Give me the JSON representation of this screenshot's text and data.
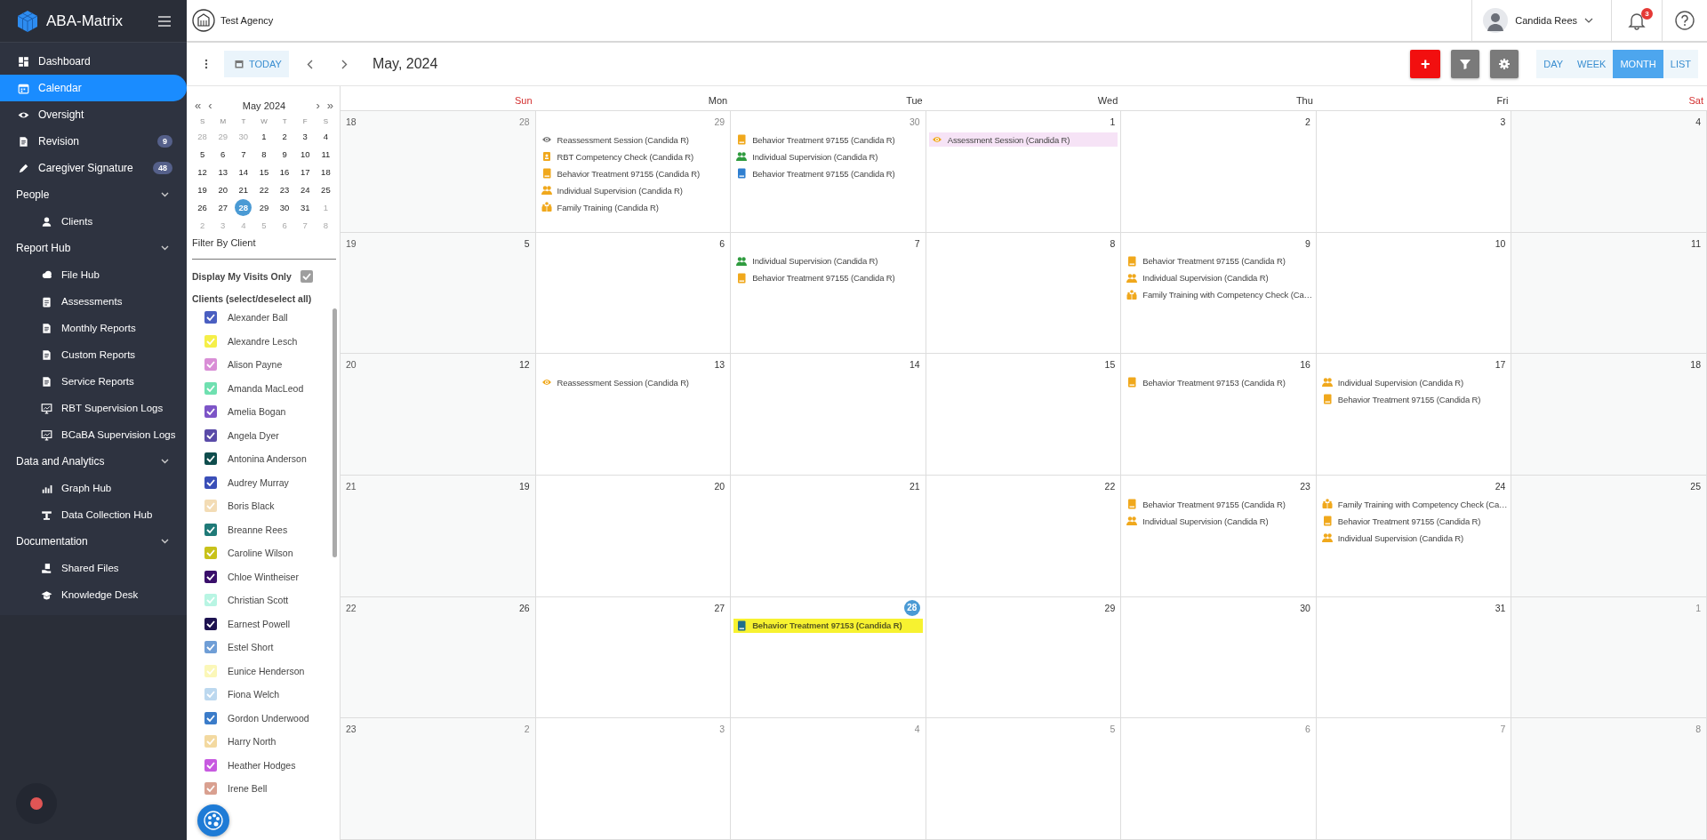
{
  "app": {
    "name": "ABA-Matrix"
  },
  "agency": {
    "name": "Test Agency"
  },
  "user": {
    "name": "Candida Rees",
    "notifications": "3"
  },
  "sidebar": {
    "items": [
      {
        "label": "Dashboard",
        "selected": false
      },
      {
        "label": "Calendar",
        "selected": true
      },
      {
        "label": "Oversight",
        "selected": false
      },
      {
        "label": "Revision",
        "selected": false,
        "badge": "9"
      },
      {
        "label": "Caregiver Signature",
        "selected": false,
        "badge": "48"
      },
      {
        "label": "People",
        "expanded": true,
        "children": [
          {
            "label": "Clients",
            "selected": false
          }
        ]
      },
      {
        "label": "Report Hub",
        "expanded": true,
        "children": [
          {
            "label": "File Hub",
            "selected": false
          },
          {
            "label": "Assessments",
            "selected": false
          },
          {
            "label": "Monthly Reports",
            "selected": false
          },
          {
            "label": "Custom Reports",
            "selected": false
          },
          {
            "label": "Service Reports",
            "selected": false
          },
          {
            "label": "RBT Supervision Logs",
            "selected": false
          },
          {
            "label": "BCaBA Supervision Logs",
            "selected": false
          }
        ]
      },
      {
        "label": "Data and Analytics",
        "expanded": true,
        "children": [
          {
            "label": "Graph Hub",
            "selected": false
          },
          {
            "label": "Data Collection Hub",
            "selected": false
          }
        ]
      },
      {
        "label": "Documentation",
        "expanded": true,
        "children": [
          {
            "label": "Shared Files",
            "selected": false
          },
          {
            "label": "Knowledge Desk",
            "selected": false
          }
        ]
      }
    ]
  },
  "toolbar": {
    "today": "TODAY",
    "period": "May, 2024",
    "add": "+",
    "views": [
      {
        "label": "DAY",
        "selected": false
      },
      {
        "label": "WEEK",
        "selected": false
      },
      {
        "label": "MONTH",
        "selected": true
      },
      {
        "label": "LIST",
        "selected": false
      }
    ]
  },
  "mini_calendar": {
    "title": "May 2024",
    "first": "«",
    "prev": "‹",
    "next": "›",
    "last": "»",
    "weekdays": [
      "S",
      "M",
      "T",
      "W",
      "T",
      "F",
      "S"
    ],
    "weeks": [
      [
        {
          "day": "28",
          "other_month": true,
          "selected": false
        },
        {
          "day": "29",
          "other_month": true,
          "selected": false
        },
        {
          "day": "30",
          "other_month": true,
          "selected": false
        },
        {
          "day": "1",
          "other_month": false,
          "selected": false
        },
        {
          "day": "2",
          "other_month": false,
          "selected": false
        },
        {
          "day": "3",
          "other_month": false,
          "selected": false
        },
        {
          "day": "4",
          "other_month": false,
          "selected": false
        }
      ],
      [
        {
          "day": "5",
          "other_month": false,
          "selected": false
        },
        {
          "day": "6",
          "other_month": false,
          "selected": false
        },
        {
          "day": "7",
          "other_month": false,
          "selected": false
        },
        {
          "day": "8",
          "other_month": false,
          "selected": false
        },
        {
          "day": "9",
          "other_month": false,
          "selected": false
        },
        {
          "day": "10",
          "other_month": false,
          "selected": false
        },
        {
          "day": "11",
          "other_month": false,
          "selected": false
        }
      ],
      [
        {
          "day": "12",
          "other_month": false,
          "selected": false
        },
        {
          "day": "13",
          "other_month": false,
          "selected": false
        },
        {
          "day": "14",
          "other_month": false,
          "selected": false
        },
        {
          "day": "15",
          "other_month": false,
          "selected": false
        },
        {
          "day": "16",
          "other_month": false,
          "selected": false
        },
        {
          "day": "17",
          "other_month": false,
          "selected": false
        },
        {
          "day": "18",
          "other_month": false,
          "selected": false
        }
      ],
      [
        {
          "day": "19",
          "other_month": false,
          "selected": false
        },
        {
          "day": "20",
          "other_month": false,
          "selected": false
        },
        {
          "day": "21",
          "other_month": false,
          "selected": false
        },
        {
          "day": "22",
          "other_month": false,
          "selected": false
        },
        {
          "day": "23",
          "other_month": false,
          "selected": false
        },
        {
          "day": "24",
          "other_month": false,
          "selected": false
        },
        {
          "day": "25",
          "other_month": false,
          "selected": false
        }
      ],
      [
        {
          "day": "26",
          "other_month": false,
          "selected": false
        },
        {
          "day": "27",
          "other_month": false,
          "selected": false
        },
        {
          "day": "28",
          "other_month": false,
          "selected": true
        },
        {
          "day": "29",
          "other_month": false,
          "selected": false
        },
        {
          "day": "30",
          "other_month": false,
          "selected": false
        },
        {
          "day": "31",
          "other_month": false,
          "selected": false
        },
        {
          "day": "1",
          "other_month": true,
          "selected": false
        }
      ],
      [
        {
          "day": "2",
          "other_month": true,
          "selected": false
        },
        {
          "day": "3",
          "other_month": true,
          "selected": false
        },
        {
          "day": "4",
          "other_month": true,
          "selected": false
        },
        {
          "day": "5",
          "other_month": true,
          "selected": false
        },
        {
          "day": "6",
          "other_month": true,
          "selected": false
        },
        {
          "day": "7",
          "other_month": true,
          "selected": false
        },
        {
          "day": "8",
          "other_month": true,
          "selected": false
        }
      ]
    ]
  },
  "filter": {
    "title": "Filter By Client",
    "my_visits": {
      "label": "Display My Visits Only",
      "checked": true
    },
    "clients_heading": "Clients (select/deselect all)",
    "clients": [
      {
        "name": "Alexander Ball",
        "color": "#4a5fc1",
        "checked": true
      },
      {
        "name": "Alexandre Lesch",
        "color": "#f5ef48",
        "checked": true
      },
      {
        "name": "Alison Payne",
        "color": "#d98ed6",
        "checked": true
      },
      {
        "name": "Amanda MacLeod",
        "color": "#6fe0b0",
        "checked": true
      },
      {
        "name": "Amelia Bogan",
        "color": "#7d55c7",
        "checked": true
      },
      {
        "name": "Angela Dyer",
        "color": "#5a4ba8",
        "checked": true
      },
      {
        "name": "Antonina Anderson",
        "color": "#0f4d4d",
        "checked": true
      },
      {
        "name": "Audrey Murray",
        "color": "#3a4fb8",
        "checked": true
      },
      {
        "name": "Boris Black",
        "color": "#f3dcb5",
        "checked": true
      },
      {
        "name": "Breanne Rees",
        "color": "#1f7a78",
        "checked": true
      },
      {
        "name": "Caroline Wilson",
        "color": "#c8c21a",
        "checked": true
      },
      {
        "name": "Chloe Wintheiser",
        "color": "#3a0f6b",
        "checked": true
      },
      {
        "name": "Christian Scott",
        "color": "#b8f5e3",
        "checked": true
      },
      {
        "name": "Earnest Powell",
        "color": "#1d1250",
        "checked": true
      },
      {
        "name": "Estel Short",
        "color": "#6f9ed6",
        "checked": true
      },
      {
        "name": "Eunice Henderson",
        "color": "#fbf7b8",
        "checked": true
      },
      {
        "name": "Fiona Welch",
        "color": "#bcd8ef",
        "checked": true
      },
      {
        "name": "Gordon Underwood",
        "color": "#3b7cc9",
        "checked": true
      },
      {
        "name": "Harry North",
        "color": "#f3d9a0",
        "checked": true
      },
      {
        "name": "Heather Hodges",
        "color": "#c75ae0",
        "checked": true
      },
      {
        "name": "Irene Bell",
        "color": "#d9a090",
        "checked": true
      }
    ]
  },
  "calendar": {
    "weekdays": [
      {
        "label": "Sun",
        "weekend": true
      },
      {
        "label": "Mon",
        "weekend": false
      },
      {
        "label": "Tue",
        "weekend": false
      },
      {
        "label": "Wed",
        "weekend": false
      },
      {
        "label": "Thu",
        "weekend": false
      },
      {
        "label": "Fri",
        "weekend": false
      },
      {
        "label": "Sat",
        "weekend": true
      }
    ],
    "weeks": [
      {
        "number": "18",
        "days": [
          {
            "date": "28",
            "other_month": true,
            "today": false
          },
          {
            "date": "29",
            "other_month": true,
            "today": false,
            "events": [
              {
                "kind": "assessment",
                "title": "Reassessment Session (Candida R)",
                "color": "#757575"
              },
              {
                "kind": "competency",
                "title": "RBT Competency Check (Candida R)",
                "color": "#f0a81c"
              },
              {
                "kind": "treatment",
                "title": "Behavior Treatment 97155 (Candida R)",
                "color": "#f0a81c"
              },
              {
                "kind": "supervision",
                "title": "Individual Supervision (Candida R)",
                "color": "#f0a81c"
              },
              {
                "kind": "family",
                "title": "Family Training (Candida R)",
                "color": "#f0a81c"
              }
            ]
          },
          {
            "date": "30",
            "other_month": true,
            "today": false,
            "events": [
              {
                "kind": "treatment",
                "title": "Behavior Treatment 97155 (Candida R)",
                "color": "#f0a81c"
              },
              {
                "kind": "supervision",
                "title": "Individual Supervision (Candida R)",
                "color": "#2e9b3e"
              },
              {
                "kind": "treatment",
                "title": "Behavior Treatment 97155 (Candida R)",
                "color": "#2f7fd0"
              }
            ]
          },
          {
            "date": "1",
            "other_month": false,
            "today": false,
            "events": [
              {
                "kind": "assessment",
                "title": "Assessment Session (Candida R)",
                "color": "#f0a81c",
                "highlighted": true
              }
            ]
          },
          {
            "date": "2",
            "other_month": false,
            "today": false
          },
          {
            "date": "3",
            "other_month": false,
            "today": false
          },
          {
            "date": "4",
            "other_month": false,
            "today": false
          }
        ]
      },
      {
        "number": "19",
        "days": [
          {
            "date": "5",
            "other_month": false,
            "today": false
          },
          {
            "date": "6",
            "other_month": false,
            "today": false
          },
          {
            "date": "7",
            "other_month": false,
            "today": false,
            "events": [
              {
                "kind": "supervision",
                "title": "Individual Supervision (Candida R)",
                "color": "#2e9b3e"
              },
              {
                "kind": "treatment",
                "title": "Behavior Treatment 97155 (Candida R)",
                "color": "#f0a81c"
              }
            ]
          },
          {
            "date": "8",
            "other_month": false,
            "today": false
          },
          {
            "date": "9",
            "other_month": false,
            "today": false,
            "events": [
              {
                "kind": "treatment",
                "title": "Behavior Treatment 97155 (Candida R)",
                "color": "#f0a81c"
              },
              {
                "kind": "supervision",
                "title": "Individual Supervision (Candida R)",
                "color": "#f0a81c"
              },
              {
                "kind": "family",
                "title": "Family Training with Competency Check (Ca…",
                "color": "#f0a81c"
              }
            ]
          },
          {
            "date": "10",
            "other_month": false,
            "today": false
          },
          {
            "date": "11",
            "other_month": false,
            "today": false
          }
        ]
      },
      {
        "number": "20",
        "days": [
          {
            "date": "12",
            "other_month": false,
            "today": false
          },
          {
            "date": "13",
            "other_month": false,
            "today": false,
            "events": [
              {
                "kind": "assessment",
                "title": "Reassessment Session (Candida R)",
                "color": "#f0a81c"
              }
            ]
          },
          {
            "date": "14",
            "other_month": false,
            "today": false
          },
          {
            "date": "15",
            "other_month": false,
            "today": false
          },
          {
            "date": "16",
            "other_month": false,
            "today": false,
            "events": [
              {
                "kind": "treatment",
                "title": "Behavior Treatment 97153 (Candida R)",
                "color": "#f0a81c"
              }
            ]
          },
          {
            "date": "17",
            "other_month": false,
            "today": false,
            "events": [
              {
                "kind": "supervision",
                "title": "Individual Supervision (Candida R)",
                "color": "#f0a81c"
              },
              {
                "kind": "treatment",
                "title": "Behavior Treatment 97155 (Candida R)",
                "color": "#f0a81c"
              }
            ]
          },
          {
            "date": "18",
            "other_month": false,
            "today": false
          }
        ]
      },
      {
        "number": "21",
        "days": [
          {
            "date": "19",
            "other_month": false,
            "today": false
          },
          {
            "date": "20",
            "other_month": false,
            "today": false
          },
          {
            "date": "21",
            "other_month": false,
            "today": false
          },
          {
            "date": "22",
            "other_month": false,
            "today": false
          },
          {
            "date": "23",
            "other_month": false,
            "today": false,
            "events": [
              {
                "kind": "treatment",
                "title": "Behavior Treatment 97155 (Candida R)",
                "color": "#f0a81c"
              },
              {
                "kind": "supervision",
                "title": "Individual Supervision (Candida R)",
                "color": "#f0a81c"
              }
            ]
          },
          {
            "date": "24",
            "other_month": false,
            "today": false,
            "events": [
              {
                "kind": "family",
                "title": "Family Training with Competency Check (Ca…",
                "color": "#f0a81c"
              },
              {
                "kind": "treatment",
                "title": "Behavior Treatment 97155 (Candida R)",
                "color": "#f0a81c"
              },
              {
                "kind": "supervision",
                "title": "Individual Supervision (Candida R)",
                "color": "#f0a81c"
              }
            ]
          },
          {
            "date": "25",
            "other_month": false,
            "today": false
          }
        ]
      },
      {
        "number": "22",
        "days": [
          {
            "date": "26",
            "other_month": false,
            "today": false
          },
          {
            "date": "27",
            "other_month": false,
            "today": false
          },
          {
            "date": "28",
            "other_month": false,
            "today": true,
            "events": [
              {
                "kind": "treatment",
                "title": "Behavior Treatment 97153 (Candida R)",
                "color": "#1f6f8b",
                "highlighted": true
              }
            ]
          },
          {
            "date": "29",
            "other_month": false,
            "today": false
          },
          {
            "date": "30",
            "other_month": false,
            "today": false
          },
          {
            "date": "31",
            "other_month": false,
            "today": false
          },
          {
            "date": "1",
            "other_month": true,
            "today": false
          }
        ]
      },
      {
        "number": "23",
        "days": [
          {
            "date": "2",
            "other_month": true,
            "today": false
          },
          {
            "date": "3",
            "other_month": true,
            "today": false
          },
          {
            "date": "4",
            "other_month": true,
            "today": false
          },
          {
            "date": "5",
            "other_month": true,
            "today": false
          },
          {
            "date": "6",
            "other_month": true,
            "today": false
          },
          {
            "date": "7",
            "other_month": true,
            "today": false
          },
          {
            "date": "8",
            "other_month": true,
            "today": false
          }
        ]
      }
    ]
  }
}
